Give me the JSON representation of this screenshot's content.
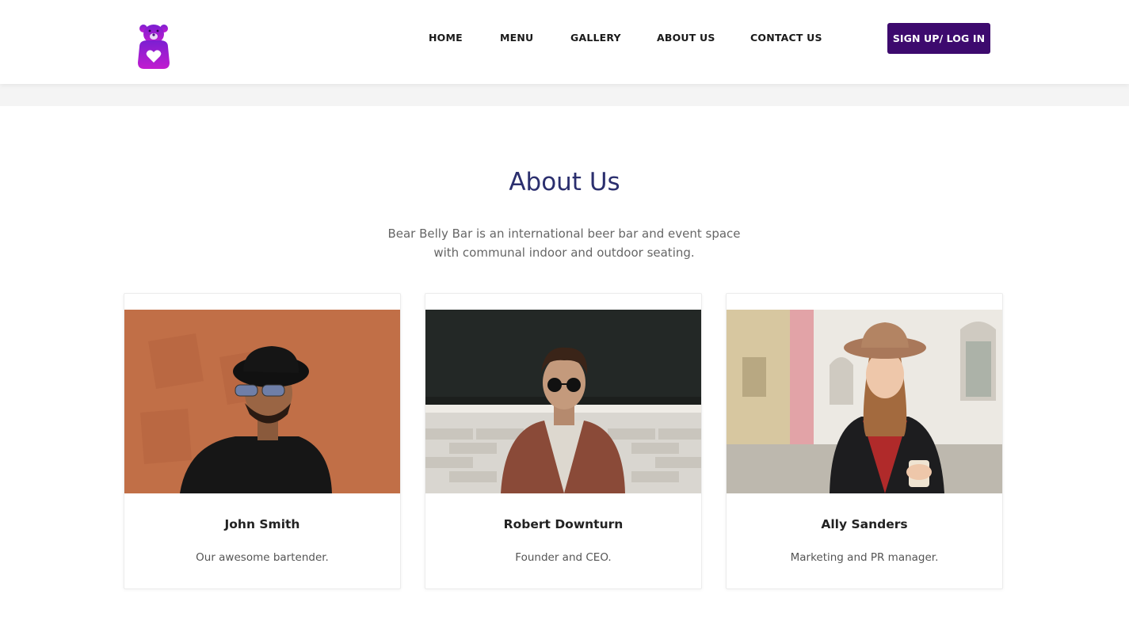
{
  "brand": {
    "accent": "#3d0a6e",
    "logo_colors": [
      "#7b1fd1",
      "#c21cd0"
    ],
    "logo_icon": "bear-heart-icon"
  },
  "nav": {
    "items": [
      {
        "label": "HOME"
      },
      {
        "label": "MENU"
      },
      {
        "label": "GALLERY"
      },
      {
        "label": "ABOUT US"
      },
      {
        "label": "CONTACT US"
      }
    ],
    "cta_label": "SIGN UP/ LOG IN"
  },
  "about": {
    "title": "About Us",
    "description": "Bear Belly Bar is an international beer bar and event space with communal indoor and outdoor seating.",
    "title_color": "#2b2f6e"
  },
  "team": [
    {
      "name": "John Smith",
      "role": "Our awesome bartender."
    },
    {
      "name": "Robert Downturn",
      "role": "Founder and CEO."
    },
    {
      "name": "Ally Sanders",
      "role": "Marketing and PR manager."
    }
  ]
}
